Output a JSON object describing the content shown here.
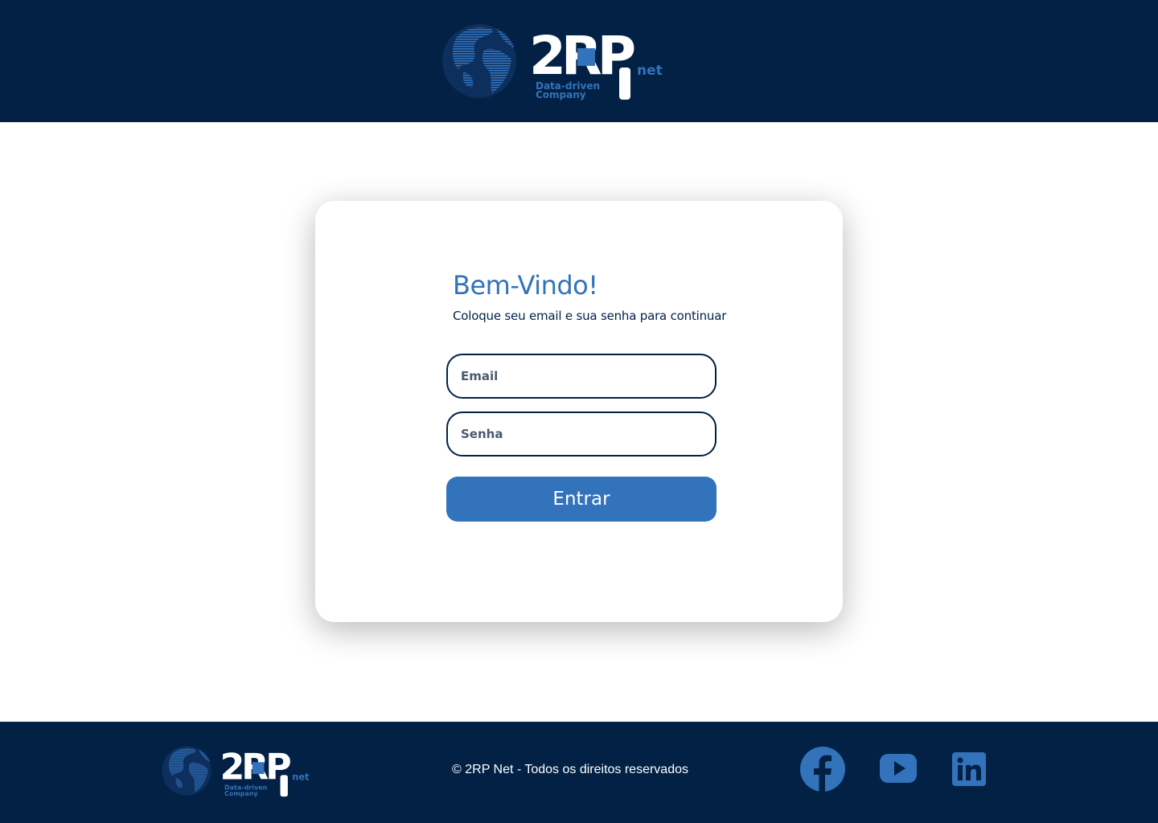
{
  "brand": {
    "name": "2RP",
    "suffix": "net",
    "tagline_line1": "Data-driven",
    "tagline_line2": "Company"
  },
  "login": {
    "title": "Bem-Vindo!",
    "subtitle": "Coloque seu email e sua senha para continuar",
    "email_placeholder": "Email",
    "password_placeholder": "Senha",
    "submit_label": "Entrar"
  },
  "footer": {
    "copyright": "© 2RP Net - Todos os direitos reservados",
    "social": [
      "facebook-icon",
      "youtube-icon",
      "linkedin-icon"
    ]
  },
  "colors": {
    "navy": "#022145",
    "accent": "#3373BB",
    "white": "#FFFFFF"
  }
}
